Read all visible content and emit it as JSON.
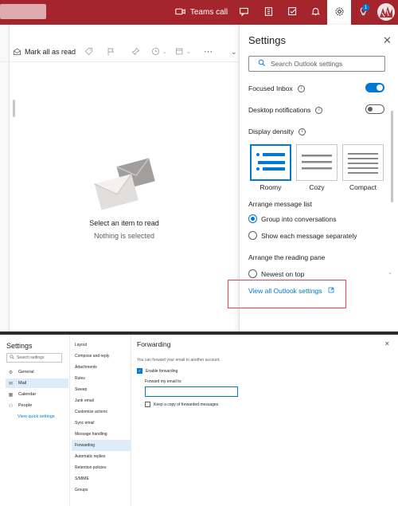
{
  "header": {
    "teams_call_label": "Teams call",
    "notification_count": "1",
    "accent_color": "#a4262c"
  },
  "toolbar": {
    "mark_all_read": "Mark all as read",
    "more": "···"
  },
  "reading_pane": {
    "empty_title": "Select an item to read",
    "empty_subtitle": "Nothing is selected"
  },
  "settings_panel": {
    "title": "Settings",
    "close": "✕",
    "search_placeholder": "Search Outlook settings",
    "focused_inbox": {
      "label": "Focused Inbox",
      "on": true
    },
    "desktop_notifications": {
      "label": "Desktop notifications",
      "on": false
    },
    "display_density": {
      "label": "Display density",
      "options": [
        "Roomy",
        "Cozy",
        "Compact"
      ],
      "selected": "Roomy"
    },
    "arrange_message_list": {
      "label": "Arrange message list",
      "options": [
        "Group into conversations",
        "Show each message separately"
      ],
      "selected": "Group into conversations"
    },
    "reading_pane": {
      "label": "Arrange the reading pane",
      "options": [
        "Newest on top"
      ]
    },
    "view_all": "View all Outlook settings"
  },
  "full_settings": {
    "title": "Settings",
    "search_placeholder": "Search settings",
    "nav": [
      {
        "label": "General",
        "icon": "gear-icon"
      },
      {
        "label": "Mail",
        "icon": "mail-icon"
      },
      {
        "label": "Calendar",
        "icon": "calendar-icon"
      },
      {
        "label": "People",
        "icon": "people-icon"
      }
    ],
    "selected_nav": "Mail",
    "view_quick_settings": "View quick settings",
    "mail_sections": [
      "Layout",
      "Compose and reply",
      "Attachments",
      "Rules",
      "Sweep",
      "Junk email",
      "Customize actions",
      "Sync email",
      "Message handling",
      "Forwarding",
      "Automatic replies",
      "Retention policies",
      "S/MIME",
      "Groups"
    ],
    "selected_section": "Forwarding",
    "forwarding": {
      "title": "Forwarding",
      "close": "✕",
      "description": "You can forward your email to another account.",
      "enable_label": "Enable forwarding",
      "enable_checked": true,
      "forward_to_label": "Forward my email to:",
      "forward_to_value": "",
      "keep_copy_label": "Keep a copy of forwarded messages",
      "keep_copy_checked": false
    }
  }
}
